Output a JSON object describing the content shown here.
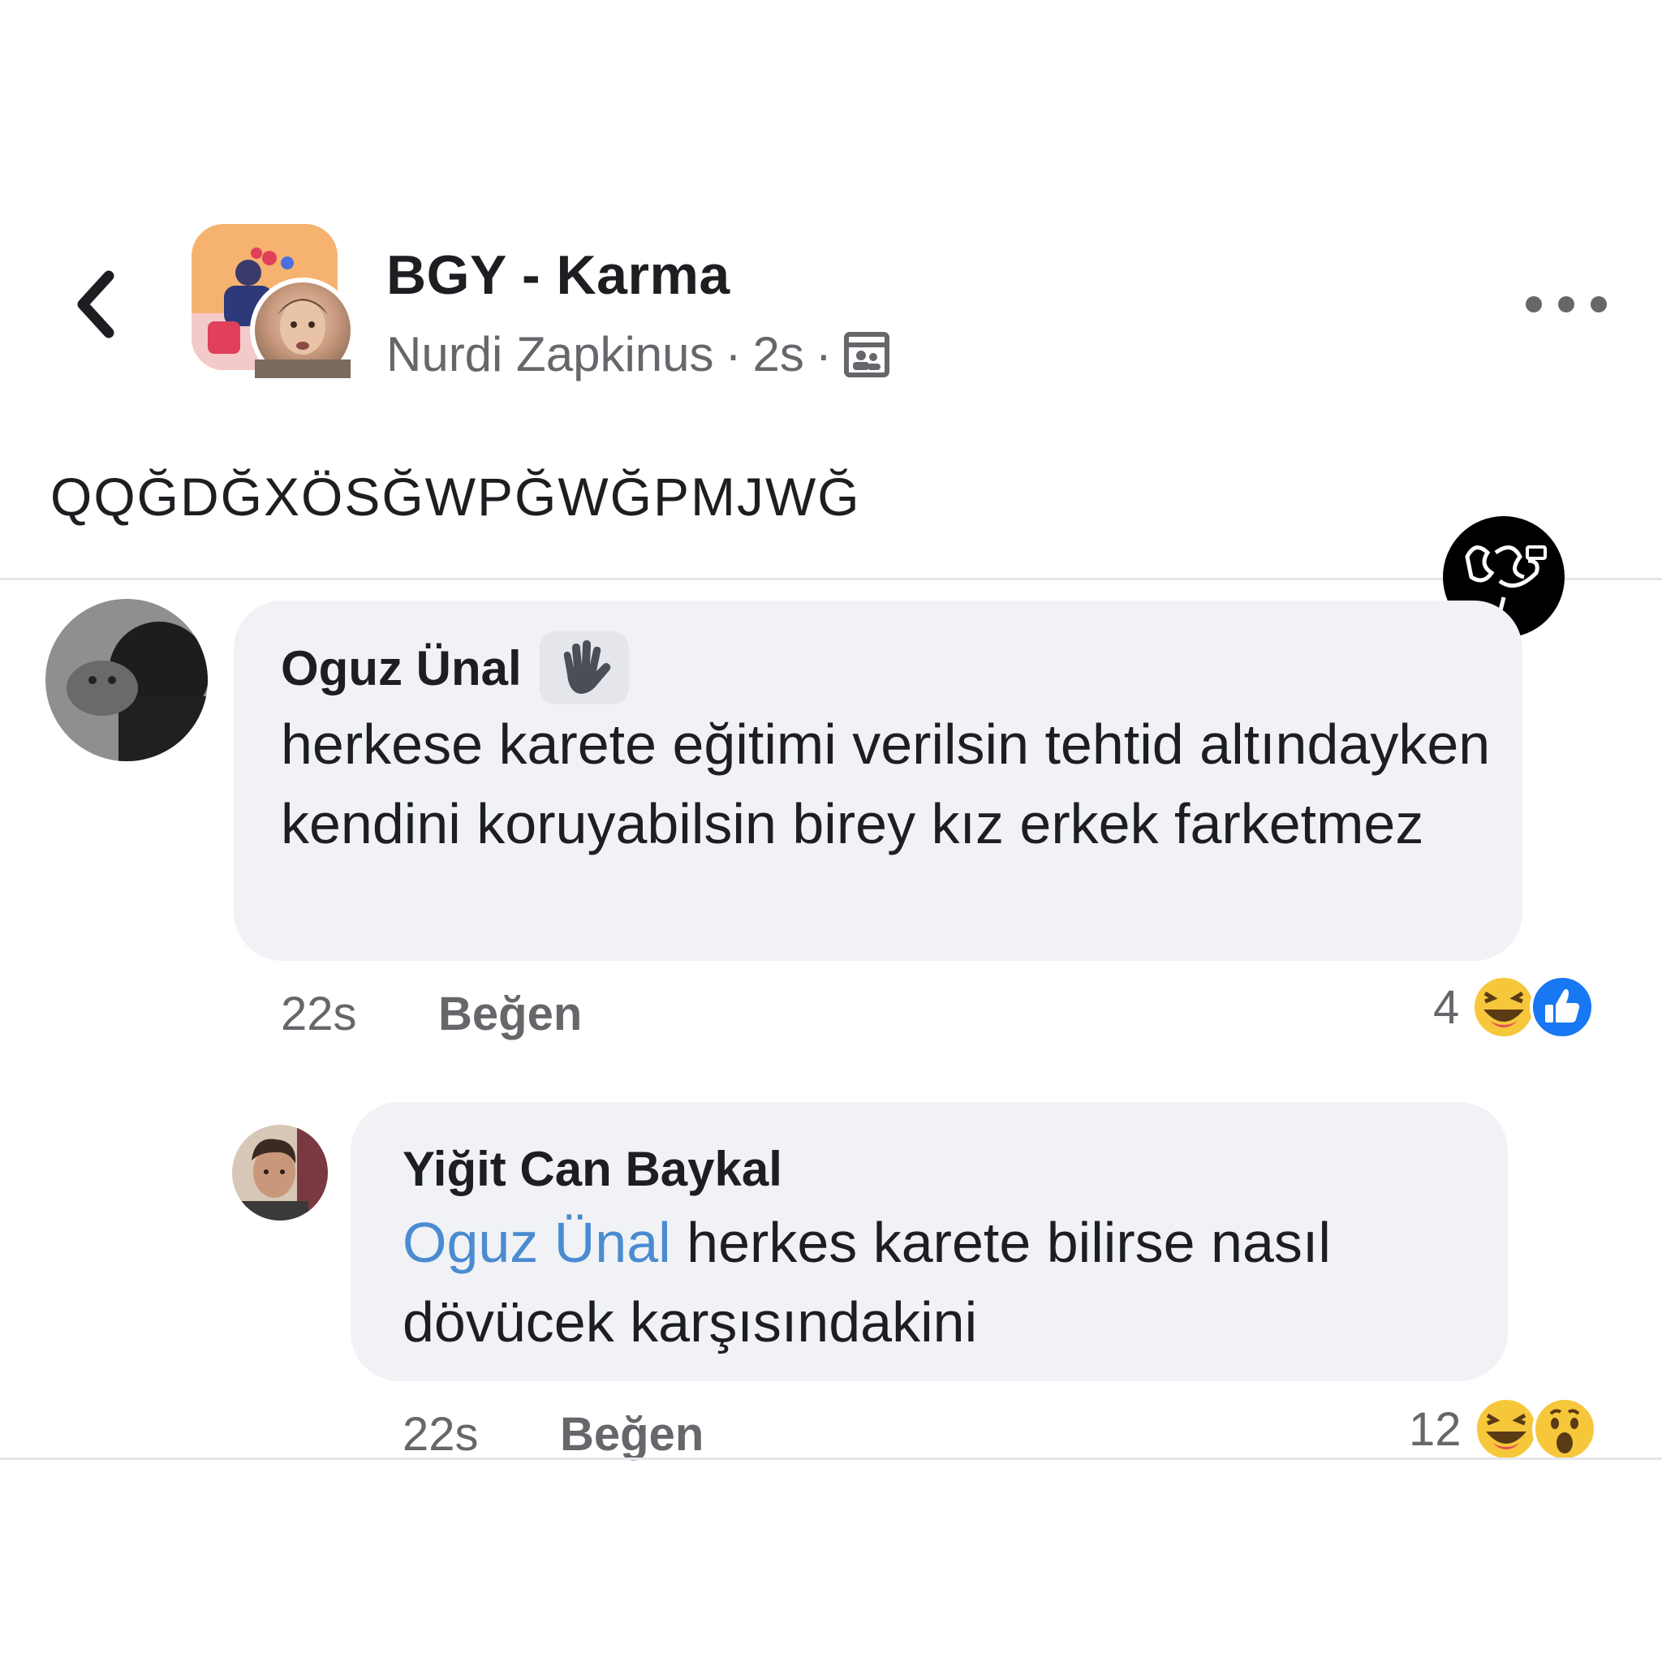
{
  "header": {
    "group_name": "BGY - Karma",
    "author": "Nurdi Zapkinus",
    "time": "2s",
    "separator": "·"
  },
  "post": {
    "text": "QQĞDĞXÖSĞWPĞWĞPMJWĞ"
  },
  "comments": [
    {
      "name": "Oguz Ünal",
      "text": "herkese karete eğitimi verilsin tehtid altındayken kendini koruyabilsin birey  kız erkek farketmez",
      "time": "22s",
      "like_label": "Beğen",
      "reaction_count": "4",
      "reactions": [
        "haha-emoji",
        "like-emoji"
      ]
    },
    {
      "name": "Yiğit Can Baykal",
      "mention": "Oguz Ünal",
      "text": " herkes karete bilirse nasıl dövücek karşısındakini",
      "time": "22s",
      "like_label": "Beğen",
      "reaction_count": "12",
      "reactions": [
        "haha-emoji",
        "wow-emoji"
      ]
    }
  ],
  "colors": {
    "bubble": "#f0f2f5",
    "secondary_text": "#65676b",
    "mention": "#4a8bd1",
    "like_blue": "#1877f2"
  },
  "icons": [
    "back-chevron-icon",
    "more-dots-icon",
    "group-privacy-icon",
    "wave-icon",
    "watermark-logo"
  ]
}
